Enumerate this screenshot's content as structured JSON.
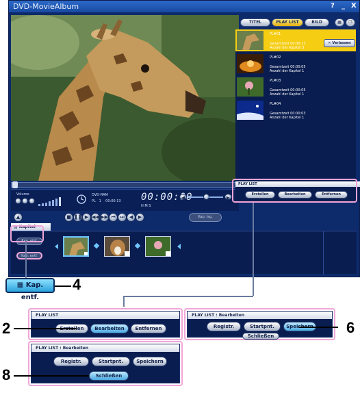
{
  "window": {
    "title": "DVD-MovieAlbum",
    "controls": [
      "?",
      "_",
      "X"
    ]
  },
  "tabs": [
    {
      "label": "TITEL"
    },
    {
      "label": "PLAY LIST",
      "active": true
    },
    {
      "label": "BILD"
    }
  ],
  "playlist_items": [
    {
      "name": "PL#01",
      "total": "Gesamtzeit 00:00:13",
      "chapters": "Anzahl der Kapitel 3",
      "selected": true
    },
    {
      "name": "PL#02",
      "total": "Gesamtzeit 00:00:05",
      "chapters": "Anzahl der Kapitel 1",
      "selected": false
    },
    {
      "name": "PL#03",
      "total": "Gesamtzeit 00:00:05",
      "chapters": "Anzahl der Kapitel 1",
      "selected": false
    },
    {
      "name": "PL#04",
      "total": "Gesamtzeit 00:00:03",
      "chapters": "Anzahl der Kapitel 1",
      "selected": false
    }
  ],
  "status": {
    "volume_label": "Volume",
    "disc": "DVD-RAM",
    "mode": "PL",
    "mode_num": "1",
    "small_time": "00:00:13",
    "timecode": "00:00:00",
    "tc_units": "H    M    S"
  },
  "playlist_panel": {
    "header": "PLAY LIST",
    "buttons": {
      "create": "Erstellen",
      "edit": "Bearbeiten",
      "remove": "Entfernen"
    }
  },
  "kap_lsg": "Kap. lsg.",
  "chapter": {
    "header": "Kapitel",
    "kap_einf": "Kap. einf.",
    "kap_entf": "Kap. entf.",
    "exit": "Verlassen"
  },
  "callouts": {
    "kap_entf_label": "Kap. entf.",
    "n4": "4",
    "n2": "2",
    "n6": "6",
    "n8": "8"
  },
  "zoom_panels": {
    "pl": {
      "header": "PLAY LIST",
      "create": "Erstellen",
      "edit": "Bearbeiten",
      "remove": "Entfernen"
    },
    "edit_a": {
      "header": "PLAY LIST : Bearbeiten",
      "register": "Registr.",
      "start": "Startpnt.",
      "save": "Speichern",
      "close": "Schließen"
    },
    "edit_b": {
      "header": "PLAY LIST : Bearbeiten",
      "register": "Registr.",
      "start": "Startpnt.",
      "save": "Speichern",
      "close": "Schließen"
    }
  },
  "colors": {
    "accent": "#f5cd12",
    "panel": "#0a1d50",
    "highlight": "#4aa8e0",
    "callout_frame": "#f1a6d8"
  }
}
